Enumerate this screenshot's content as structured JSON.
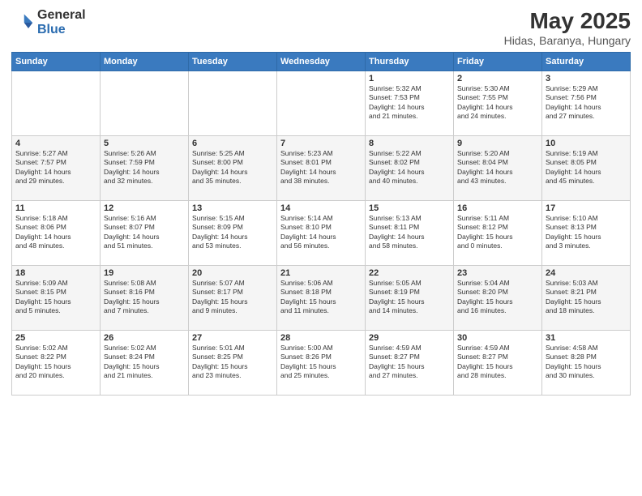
{
  "header": {
    "logo_general": "General",
    "logo_blue": "Blue",
    "month_title": "May 2025",
    "location": "Hidas, Baranya, Hungary"
  },
  "weekdays": [
    "Sunday",
    "Monday",
    "Tuesday",
    "Wednesday",
    "Thursday",
    "Friday",
    "Saturday"
  ],
  "weeks": [
    [
      {
        "day": "",
        "info": ""
      },
      {
        "day": "",
        "info": ""
      },
      {
        "day": "",
        "info": ""
      },
      {
        "day": "",
        "info": ""
      },
      {
        "day": "1",
        "info": "Sunrise: 5:32 AM\nSunset: 7:53 PM\nDaylight: 14 hours\nand 21 minutes."
      },
      {
        "day": "2",
        "info": "Sunrise: 5:30 AM\nSunset: 7:55 PM\nDaylight: 14 hours\nand 24 minutes."
      },
      {
        "day": "3",
        "info": "Sunrise: 5:29 AM\nSunset: 7:56 PM\nDaylight: 14 hours\nand 27 minutes."
      }
    ],
    [
      {
        "day": "4",
        "info": "Sunrise: 5:27 AM\nSunset: 7:57 PM\nDaylight: 14 hours\nand 29 minutes."
      },
      {
        "day": "5",
        "info": "Sunrise: 5:26 AM\nSunset: 7:59 PM\nDaylight: 14 hours\nand 32 minutes."
      },
      {
        "day": "6",
        "info": "Sunrise: 5:25 AM\nSunset: 8:00 PM\nDaylight: 14 hours\nand 35 minutes."
      },
      {
        "day": "7",
        "info": "Sunrise: 5:23 AM\nSunset: 8:01 PM\nDaylight: 14 hours\nand 38 minutes."
      },
      {
        "day": "8",
        "info": "Sunrise: 5:22 AM\nSunset: 8:02 PM\nDaylight: 14 hours\nand 40 minutes."
      },
      {
        "day": "9",
        "info": "Sunrise: 5:20 AM\nSunset: 8:04 PM\nDaylight: 14 hours\nand 43 minutes."
      },
      {
        "day": "10",
        "info": "Sunrise: 5:19 AM\nSunset: 8:05 PM\nDaylight: 14 hours\nand 45 minutes."
      }
    ],
    [
      {
        "day": "11",
        "info": "Sunrise: 5:18 AM\nSunset: 8:06 PM\nDaylight: 14 hours\nand 48 minutes."
      },
      {
        "day": "12",
        "info": "Sunrise: 5:16 AM\nSunset: 8:07 PM\nDaylight: 14 hours\nand 51 minutes."
      },
      {
        "day": "13",
        "info": "Sunrise: 5:15 AM\nSunset: 8:09 PM\nDaylight: 14 hours\nand 53 minutes."
      },
      {
        "day": "14",
        "info": "Sunrise: 5:14 AM\nSunset: 8:10 PM\nDaylight: 14 hours\nand 56 minutes."
      },
      {
        "day": "15",
        "info": "Sunrise: 5:13 AM\nSunset: 8:11 PM\nDaylight: 14 hours\nand 58 minutes."
      },
      {
        "day": "16",
        "info": "Sunrise: 5:11 AM\nSunset: 8:12 PM\nDaylight: 15 hours\nand 0 minutes."
      },
      {
        "day": "17",
        "info": "Sunrise: 5:10 AM\nSunset: 8:13 PM\nDaylight: 15 hours\nand 3 minutes."
      }
    ],
    [
      {
        "day": "18",
        "info": "Sunrise: 5:09 AM\nSunset: 8:15 PM\nDaylight: 15 hours\nand 5 minutes."
      },
      {
        "day": "19",
        "info": "Sunrise: 5:08 AM\nSunset: 8:16 PM\nDaylight: 15 hours\nand 7 minutes."
      },
      {
        "day": "20",
        "info": "Sunrise: 5:07 AM\nSunset: 8:17 PM\nDaylight: 15 hours\nand 9 minutes."
      },
      {
        "day": "21",
        "info": "Sunrise: 5:06 AM\nSunset: 8:18 PM\nDaylight: 15 hours\nand 11 minutes."
      },
      {
        "day": "22",
        "info": "Sunrise: 5:05 AM\nSunset: 8:19 PM\nDaylight: 15 hours\nand 14 minutes."
      },
      {
        "day": "23",
        "info": "Sunrise: 5:04 AM\nSunset: 8:20 PM\nDaylight: 15 hours\nand 16 minutes."
      },
      {
        "day": "24",
        "info": "Sunrise: 5:03 AM\nSunset: 8:21 PM\nDaylight: 15 hours\nand 18 minutes."
      }
    ],
    [
      {
        "day": "25",
        "info": "Sunrise: 5:02 AM\nSunset: 8:22 PM\nDaylight: 15 hours\nand 20 minutes."
      },
      {
        "day": "26",
        "info": "Sunrise: 5:02 AM\nSunset: 8:24 PM\nDaylight: 15 hours\nand 21 minutes."
      },
      {
        "day": "27",
        "info": "Sunrise: 5:01 AM\nSunset: 8:25 PM\nDaylight: 15 hours\nand 23 minutes."
      },
      {
        "day": "28",
        "info": "Sunrise: 5:00 AM\nSunset: 8:26 PM\nDaylight: 15 hours\nand 25 minutes."
      },
      {
        "day": "29",
        "info": "Sunrise: 4:59 AM\nSunset: 8:27 PM\nDaylight: 15 hours\nand 27 minutes."
      },
      {
        "day": "30",
        "info": "Sunrise: 4:59 AM\nSunset: 8:27 PM\nDaylight: 15 hours\nand 28 minutes."
      },
      {
        "day": "31",
        "info": "Sunrise: 4:58 AM\nSunset: 8:28 PM\nDaylight: 15 hours\nand 30 minutes."
      }
    ]
  ]
}
